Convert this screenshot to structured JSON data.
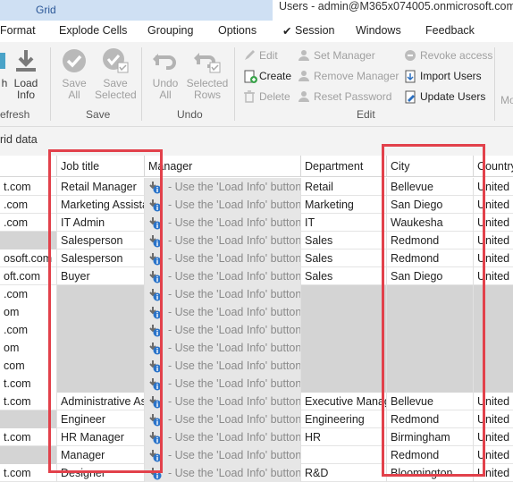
{
  "window": {
    "tab_label": "Grid",
    "title": "Users - admin@M365x074005.onmicrosoft.com (0"
  },
  "menu": {
    "items": [
      "Format",
      "Explode Cells",
      "Grouping",
      "Options",
      "Session",
      "Windows",
      "Feedback"
    ],
    "session_check": "✔"
  },
  "ribbon": {
    "refresh_partial": "h",
    "load_info": "Load Info",
    "save_all": "Save All",
    "save_selected": "Save Selected",
    "undo_all": "Undo All",
    "undo_selected_rows": "Selected Rows",
    "undo_selected_top": "Undo",
    "edit": "Edit",
    "create": "Create",
    "delete": "Delete",
    "set_manager": "Set Manager",
    "remove_manager": "Remove Manager",
    "reset_password": "Reset Password",
    "revoke_access": "Revoke access",
    "import_users": "Import Users",
    "update_users": "Update Users",
    "more_partial": "Mo",
    "groups": {
      "refresh": "efresh",
      "save": "Save",
      "undo": "Undo",
      "edit": "Edit"
    }
  },
  "subbar": {
    "label": "rid data"
  },
  "grid": {
    "columns": [
      "",
      "Job title",
      "Manager",
      "Department",
      "City",
      "Country"
    ],
    "manager_hint": "- Use the 'Load Info' button t",
    "rows": [
      {
        "upn": "t.com",
        "job": "Retail Manager",
        "dept": "Retail",
        "city": "Bellevue",
        "country": "United S",
        "grey": false
      },
      {
        "upn": ".com",
        "job": "Marketing Assista",
        "dept": "Marketing",
        "city": "San Diego",
        "country": "United S",
        "grey": false
      },
      {
        "upn": ".com",
        "job": "IT Admin",
        "dept": "IT",
        "city": "Waukesha",
        "country": "United S",
        "grey": false
      },
      {
        "upn": "",
        "job": "Salesperson",
        "dept": "Sales",
        "city": "Redmond",
        "country": "United S",
        "grey": false
      },
      {
        "upn": "osoft.com",
        "job": "Salesperson",
        "dept": "Sales",
        "city": "Redmond",
        "country": "United S",
        "grey": false
      },
      {
        "upn": "oft.com",
        "job": "Buyer",
        "dept": "Sales",
        "city": "San Diego",
        "country": "United S",
        "grey": false
      },
      {
        "upn": ".com",
        "job": "",
        "dept": "",
        "city": "",
        "country": "",
        "grey": true
      },
      {
        "upn": "om",
        "job": "",
        "dept": "",
        "city": "",
        "country": "",
        "grey": true
      },
      {
        "upn": ".com",
        "job": "",
        "dept": "",
        "city": "",
        "country": "",
        "grey": true
      },
      {
        "upn": "om",
        "job": "",
        "dept": "",
        "city": "",
        "country": "",
        "grey": true
      },
      {
        "upn": "com",
        "job": "",
        "dept": "",
        "city": "",
        "country": "",
        "grey": true
      },
      {
        "upn": "t.com",
        "job": "",
        "dept": "",
        "city": "",
        "country": "",
        "grey": true
      },
      {
        "upn": "t.com",
        "job": "Administrative As",
        "dept": "Executive Manag",
        "city": "Bellevue",
        "country": "United S",
        "grey": false
      },
      {
        "upn": "",
        "job": "Engineer",
        "dept": "Engineering",
        "city": "Redmond",
        "country": "United S",
        "grey": false
      },
      {
        "upn": "t.com",
        "job": "HR Manager",
        "dept": "HR",
        "city": "Birmingham",
        "country": "United S",
        "grey": false
      },
      {
        "upn": "",
        "job": "Manager",
        "dept": "",
        "city": "Redmond",
        "country": "United S",
        "grey": false
      },
      {
        "upn": "t.com",
        "job": "Designer",
        "dept": "R&D",
        "city": "Bloomington",
        "country": "United S",
        "grey": false
      }
    ]
  },
  "colors": {
    "highlight": "#e2414b",
    "tab": "#cfe0f3",
    "ribbon": "#f3f3f3",
    "empty_cell": "#d4d4d4"
  }
}
